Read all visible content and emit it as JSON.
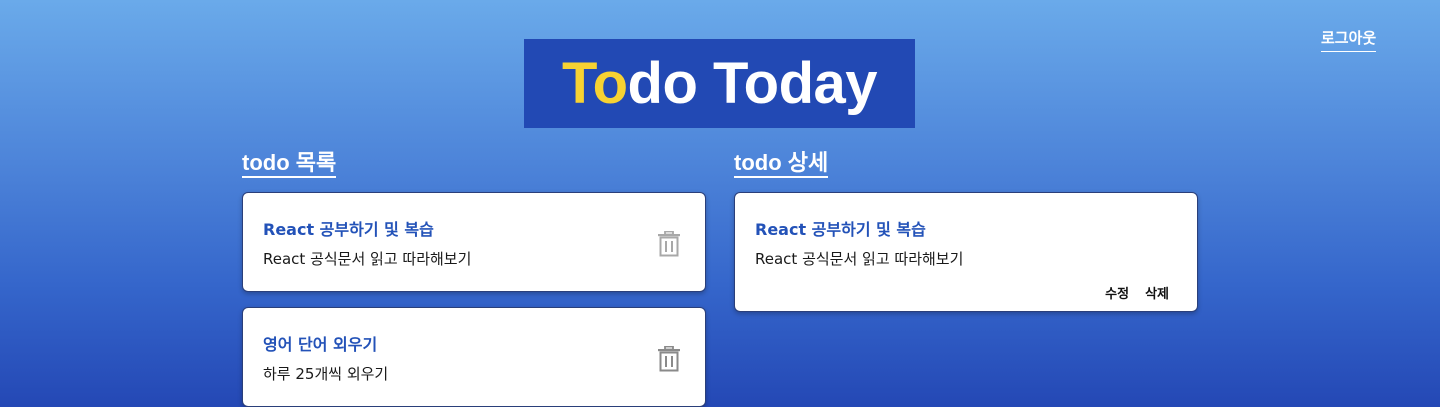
{
  "header": {
    "logout_label": "로그아웃",
    "logo_accent": "To",
    "logo_rest": "do Today"
  },
  "list": {
    "title": "todo 목록",
    "items": [
      {
        "title": "React 공부하기 및 복습",
        "description": "React 공식문서 읽고 따라해보기"
      },
      {
        "title": "영어 단어 외우기",
        "description": "하루 25개씩 외우기"
      }
    ]
  },
  "detail": {
    "title": "todo 상세",
    "item_title": "React 공부하기 및 복습",
    "item_description": "React 공식문서 읽고 따라해보기",
    "edit_label": "수정",
    "delete_label": "삭제"
  },
  "icons": {
    "trash": "trash-icon"
  },
  "colors": {
    "logo_background": "#2249b4",
    "logo_accent": "#f7d232",
    "card_title": "#2352b8",
    "background_top": "#6aaaea",
    "background_bottom": "#2448b5"
  }
}
